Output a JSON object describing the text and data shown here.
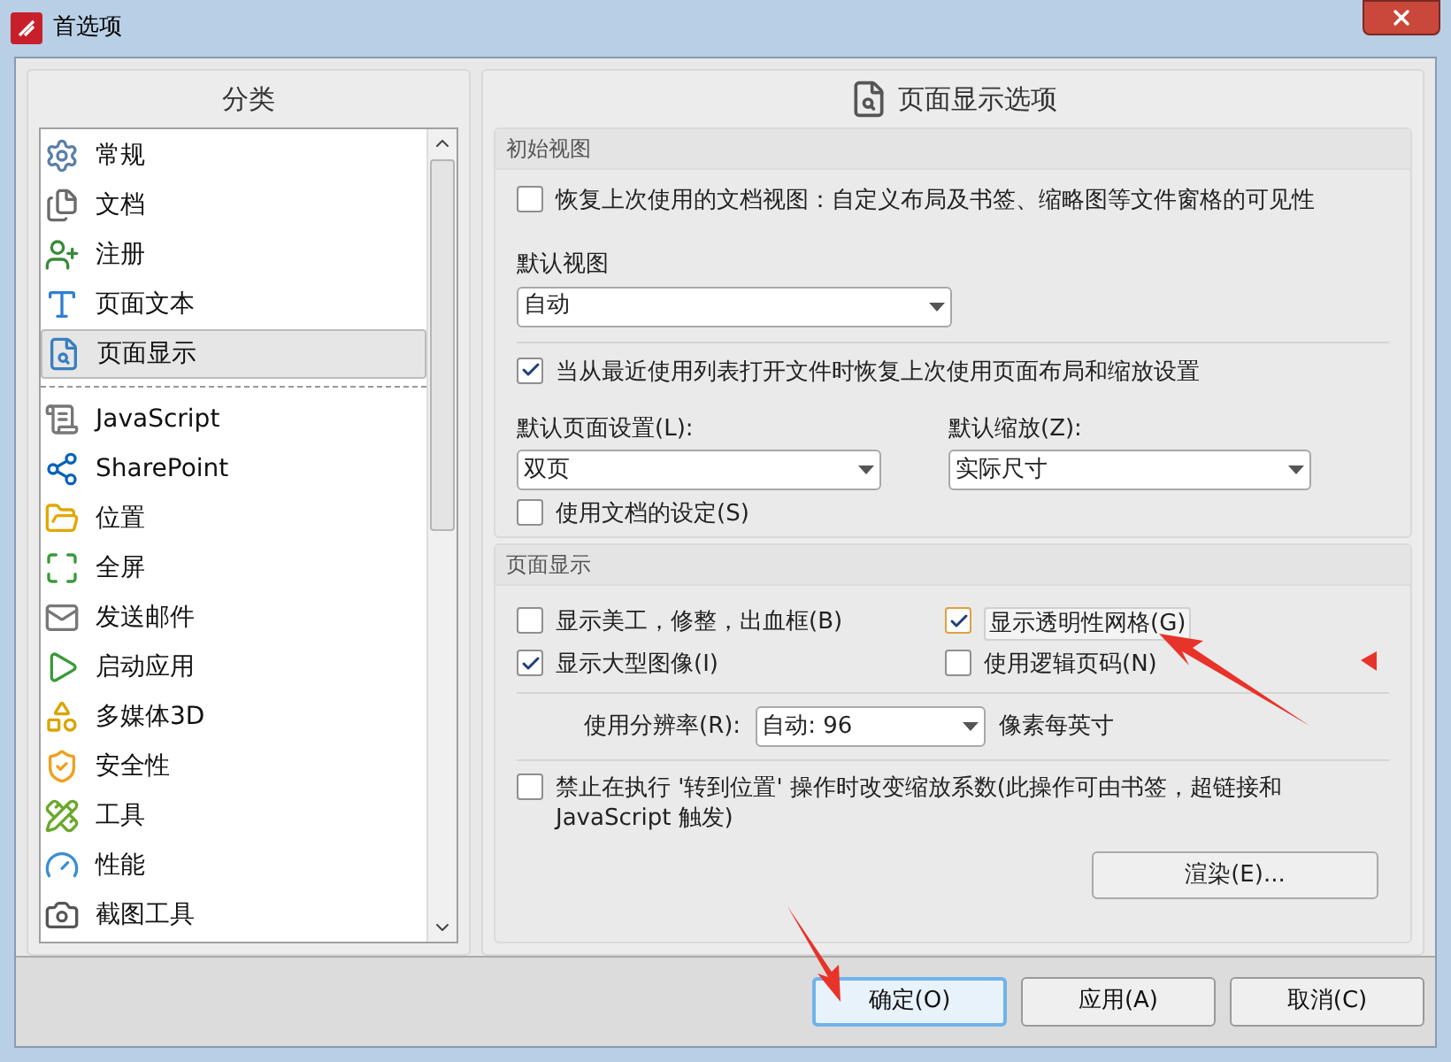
{
  "window": {
    "title": "首选项"
  },
  "sidebar": {
    "title": "分类",
    "items": [
      {
        "label": "常规",
        "selected": false
      },
      {
        "label": "文档",
        "selected": false
      },
      {
        "label": "注册",
        "selected": false
      },
      {
        "label": "页面文本",
        "selected": false
      },
      {
        "label": "页面显示",
        "selected": true
      },
      {
        "label": "JavaScript",
        "selected": false
      },
      {
        "label": "SharePoint",
        "selected": false
      },
      {
        "label": "位置",
        "selected": false
      },
      {
        "label": "全屏",
        "selected": false
      },
      {
        "label": "发送邮件",
        "selected": false
      },
      {
        "label": "启动应用",
        "selected": false
      },
      {
        "label": "多媒体3D",
        "selected": false
      },
      {
        "label": "安全性",
        "selected": false
      },
      {
        "label": "工具",
        "selected": false
      },
      {
        "label": "性能",
        "selected": false
      },
      {
        "label": "截图工具",
        "selected": false
      }
    ]
  },
  "page": {
    "title": "页面显示选项",
    "initial_view": {
      "title": "初始视图",
      "restore_view": {
        "label": "恢复上次使用的文档视图：自定义布局及书签、缩略图等文件窗格的可见性",
        "checked": false
      },
      "default_view": {
        "label": "默认视图",
        "value": "自动"
      },
      "restore_layout": {
        "label": "当从最近使用列表打开文件时恢复上次使用页面布局和缩放设置",
        "checked": true
      },
      "default_page_setting": {
        "label": "默认页面设置(L):",
        "value": "双页"
      },
      "default_zoom": {
        "label": "默认缩放(Z):",
        "value": "实际尺寸"
      },
      "use_document_settings": {
        "label": "使用文档的设定(S)",
        "checked": false
      }
    },
    "page_display": {
      "title": "页面显示",
      "options": [
        {
          "label": "显示美工，修整，出血框(B)",
          "checked": false,
          "focused": false
        },
        {
          "label": "显示透明性网格(G)",
          "checked": true,
          "focused": true
        },
        {
          "label": "显示大型图像(I)",
          "checked": true,
          "focused": false
        },
        {
          "label": "使用逻辑页码(N)",
          "checked": false,
          "focused": false
        }
      ],
      "resolution": {
        "label": "使用分辨率(R):",
        "value": "自动: 96",
        "unit": "像素每英寸"
      },
      "disable_zoom_change": {
        "label": "禁止在执行 '转到位置' 操作时改变缩放系数(此操作可由书签，超链接和 JavaScript 触发)",
        "checked": false
      },
      "render_button": "渲染(E)..."
    }
  },
  "buttons": [
    {
      "label": "确定(O)",
      "default": true
    },
    {
      "label": "应用(A)",
      "default": false
    },
    {
      "label": "取消(C)",
      "default": false
    }
  ]
}
